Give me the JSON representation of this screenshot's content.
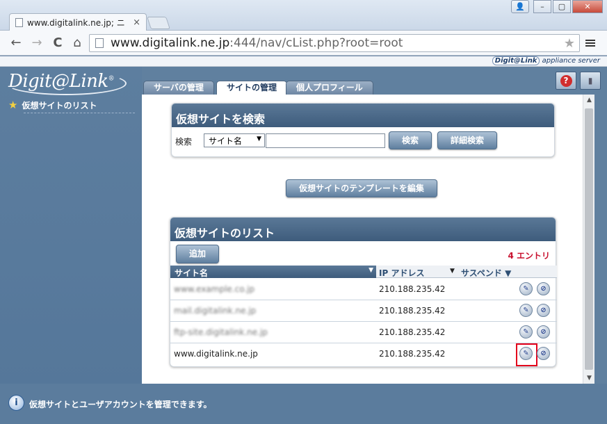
{
  "browser": {
    "tab_title": "www.digitalink.ne.jp; ニ",
    "tab_close": "×",
    "url_host": "www.digitalink.ne.jp",
    "url_rest": ":444/nav/cList.php?root=root",
    "back": "←",
    "forward": "→",
    "reload": "C",
    "home": "⌂",
    "star": "★",
    "win_user": "👤",
    "win_min": "–",
    "win_max": "▢",
    "win_close": "✕"
  },
  "app": {
    "appliance_brand": "Digit@Link",
    "appliance_text": "appliance server",
    "logo": "Digit@Link",
    "logo_mark": "®",
    "sidebar": {
      "items": [
        {
          "label": "仮想サイトのリスト"
        }
      ]
    },
    "tabs": [
      {
        "label": "サーバの管理",
        "active": false
      },
      {
        "label": "サイトの管理",
        "active": true
      },
      {
        "label": "個人プロフィール",
        "active": false
      }
    ],
    "help_icon": "?",
    "exit_icon": "▮",
    "search_panel": {
      "title": "仮想サイトを検索",
      "label": "検索",
      "select_value": "サイト名",
      "input_value": "",
      "search_button": "検索",
      "advanced_button": "詳細検索"
    },
    "template_button": "仮想サイトのテンプレートを編集",
    "list_panel": {
      "title": "仮想サイトのリスト",
      "add_button": "追加",
      "entries": "4 エントリ",
      "columns": {
        "site": "サイト名",
        "ip": "IP アドレス",
        "suspend": "サスペンド"
      },
      "rows": [
        {
          "site": "www.example.co.jp",
          "ip": "210.188.235.42",
          "blurred": true
        },
        {
          "site": "mail.digitalink.ne.jp",
          "ip": "210.188.235.42",
          "blurred": true
        },
        {
          "site": "ftp-site.digitalink.ne.jp",
          "ip": "210.188.235.42",
          "blurred": true
        },
        {
          "site": "www.digitalink.ne.jp",
          "ip": "210.188.235.42",
          "blurred": false
        }
      ],
      "edit_icon": "✎",
      "suspend_icon": "⊘"
    },
    "status_text": "仮想サイトとユーザアカウントを管理できます。",
    "info_icon": "i",
    "highlight_color": "#e3001b"
  }
}
